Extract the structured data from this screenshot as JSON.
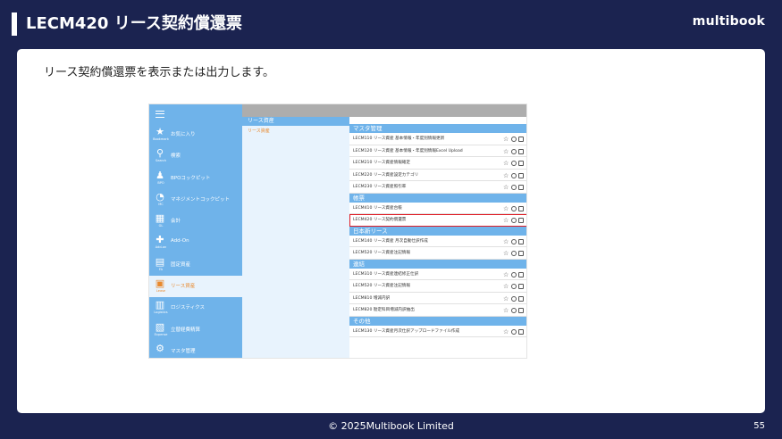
{
  "slide": {
    "title": "LECM420 リース契約償還票",
    "brand": "multibook",
    "description": "リース契約償還票を表示または出力します。",
    "copyright": "© 2025Multibook Limited",
    "page_number": "55"
  },
  "app": {
    "side_menu": [
      {
        "icon": "star-icon",
        "label": "お気に入り",
        "sub": "Bookmark",
        "active": false
      },
      {
        "icon": "search-icon",
        "label": "検索",
        "sub": "Search",
        "active": false
      },
      {
        "icon": "people-icon",
        "label": "BPOコックピット",
        "sub": "BPO",
        "active": false
      },
      {
        "icon": "gauge-icon",
        "label": "マネジメントコックピット",
        "sub": "MC",
        "active": false
      },
      {
        "icon": "calculator-icon",
        "label": "会計",
        "sub": "GL",
        "active": false
      },
      {
        "icon": "addon-icon",
        "label": "Add-On",
        "sub": "Add-on",
        "active": false
      },
      {
        "icon": "fixed-asset-icon",
        "label": "固定資産",
        "sub": "FA",
        "active": false
      },
      {
        "icon": "lease-icon",
        "label": "リース資産",
        "sub": "Lease",
        "active": true
      },
      {
        "icon": "logistics-icon",
        "label": "ロジスティクス",
        "sub": "Logistics",
        "active": false
      },
      {
        "icon": "expense-icon",
        "label": "立替経費精算",
        "sub": "Expense",
        "active": false
      },
      {
        "icon": "gear-icon",
        "label": "マスタ管理",
        "sub": "",
        "active": false
      }
    ],
    "middle": {
      "header": "リース資産",
      "selected": "リース資産"
    },
    "categories": [
      {
        "header": "マスタ管理",
        "rows": [
          {
            "label": "LECM110 リース資産 基本情報・年度別情報更新",
            "highlighted": false
          },
          {
            "label": "LECM120 リース資産 基本情報・年度別情報Excel Upload",
            "highlighted": false
          },
          {
            "label": "LECM210 リース資産情報確定",
            "highlighted": false
          },
          {
            "label": "LECM220 リース資産設定カテゴリ",
            "highlighted": false
          },
          {
            "label": "LECM230 リース資産照引率",
            "highlighted": false
          }
        ]
      },
      {
        "header": "帳票",
        "rows": [
          {
            "label": "LECM410 リース資産台帳",
            "highlighted": false
          },
          {
            "label": "LECM420 リース契約償還票",
            "highlighted": true
          }
        ]
      },
      {
        "header": "日本新リース",
        "rows": [
          {
            "label": "LECM140 リース資産 月次自動仕訳作成",
            "highlighted": false
          },
          {
            "label": "LECM520 リース資産注記情報",
            "highlighted": false
          }
        ]
      },
      {
        "header": "連結",
        "rows": [
          {
            "label": "LECM310 リース資産連結修正仕訳",
            "highlighted": false
          },
          {
            "label": "LECM520 リース資産注記情報",
            "highlighted": false
          },
          {
            "label": "LECM810 増減内訳",
            "highlighted": false
          },
          {
            "label": "LECM820 勘定科目増減内訳抽出",
            "highlighted": false
          }
        ]
      },
      {
        "header": "その他",
        "rows": [
          {
            "label": "LECM130 リース資産月次仕訳アップロードファイル作成",
            "highlighted": false
          }
        ]
      }
    ],
    "row_icons": [
      "star-icon",
      "gear-icon",
      "print-icon"
    ]
  },
  "colors": {
    "slide_bg": "#1b2350",
    "menu_blue": "#6fb3ea",
    "active_orange": "#e8892e",
    "highlight_red": "#e01b24"
  }
}
